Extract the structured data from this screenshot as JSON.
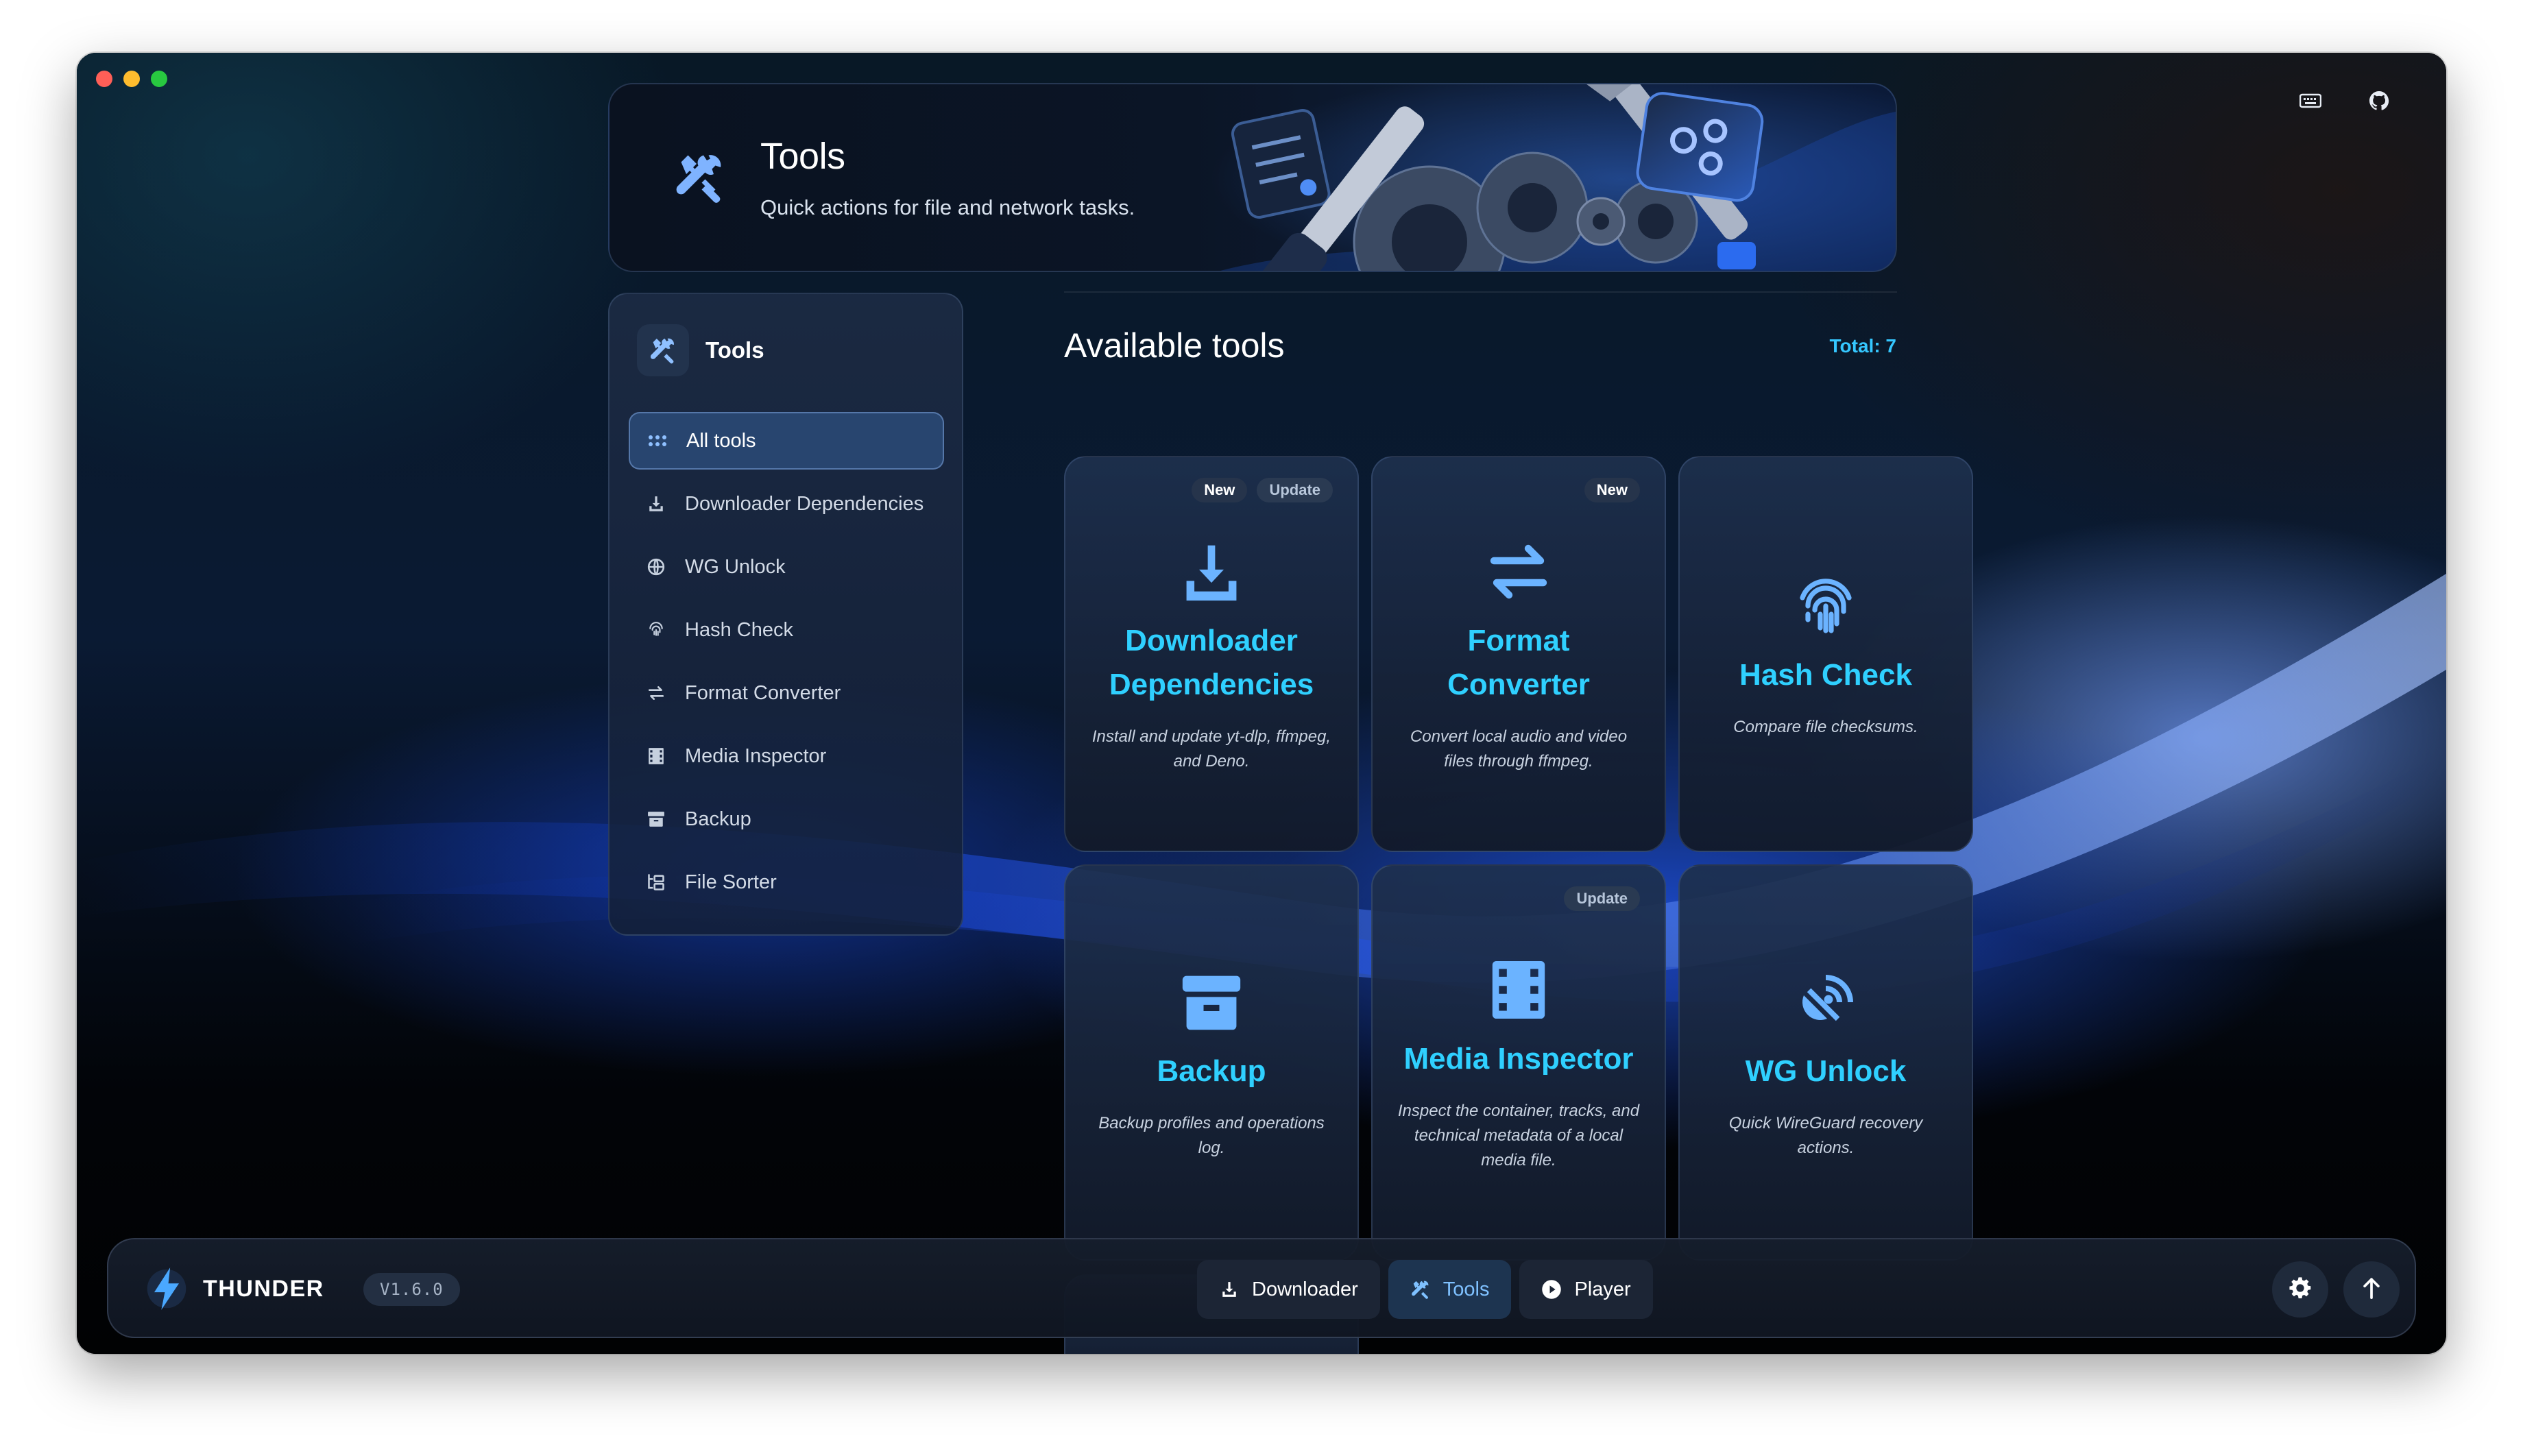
{
  "header": {
    "title": "Tools",
    "subtitle": "Quick actions for file and network tasks."
  },
  "sidebar": {
    "title": "Tools",
    "items": [
      {
        "label": "All tools",
        "icon": "grid-icon",
        "active": true
      },
      {
        "label": "Downloader Dependencies",
        "icon": "download-icon"
      },
      {
        "label": "WG Unlock",
        "icon": "globe-icon"
      },
      {
        "label": "Hash Check",
        "icon": "fingerprint-icon"
      },
      {
        "label": "Format Converter",
        "icon": "arrows-swap-icon"
      },
      {
        "label": "Media Inspector",
        "icon": "film-icon"
      },
      {
        "label": "Backup",
        "icon": "archive-icon"
      },
      {
        "label": "File Sorter",
        "icon": "folder-tree-icon"
      }
    ]
  },
  "main": {
    "title": "Available tools",
    "total": "Total: 7",
    "tools": [
      {
        "name": "Downloader Dependencies",
        "desc": "Install and update yt-dlp, ffmpeg, and Deno.",
        "icon": "download-icon",
        "badges": [
          "New",
          "Update"
        ]
      },
      {
        "name": "Format Converter",
        "desc": "Convert local audio and video files through ffmpeg.",
        "icon": "arrows-swap-icon",
        "badges": [
          "New"
        ]
      },
      {
        "name": "Hash Check",
        "desc": "Compare file checksums.",
        "icon": "fingerprint-icon",
        "badges": []
      },
      {
        "name": "Backup",
        "desc": "Backup profiles and operations log.",
        "icon": "archive-icon",
        "badges": []
      },
      {
        "name": "Media Inspector",
        "desc": "Inspect the container, tracks, and technical metadata of a local media file.",
        "icon": "film-icon",
        "badges": [
          "Update"
        ]
      },
      {
        "name": "WG Unlock",
        "desc": "Quick WireGuard recovery actions.",
        "icon": "satellite-icon",
        "badges": []
      }
    ]
  },
  "bottom_bar": {
    "brand": "THUNDER",
    "version": "V1.6.0",
    "nav": [
      {
        "label": "Downloader",
        "icon": "download-icon"
      },
      {
        "label": "Tools",
        "icon": "tools-icon",
        "active": true
      },
      {
        "label": "Player",
        "icon": "play-circle-icon"
      }
    ]
  },
  "colors": {
    "accent": "#2fd0ff",
    "icon_blue": "#6bb3ff",
    "total": "#35c7ff"
  }
}
